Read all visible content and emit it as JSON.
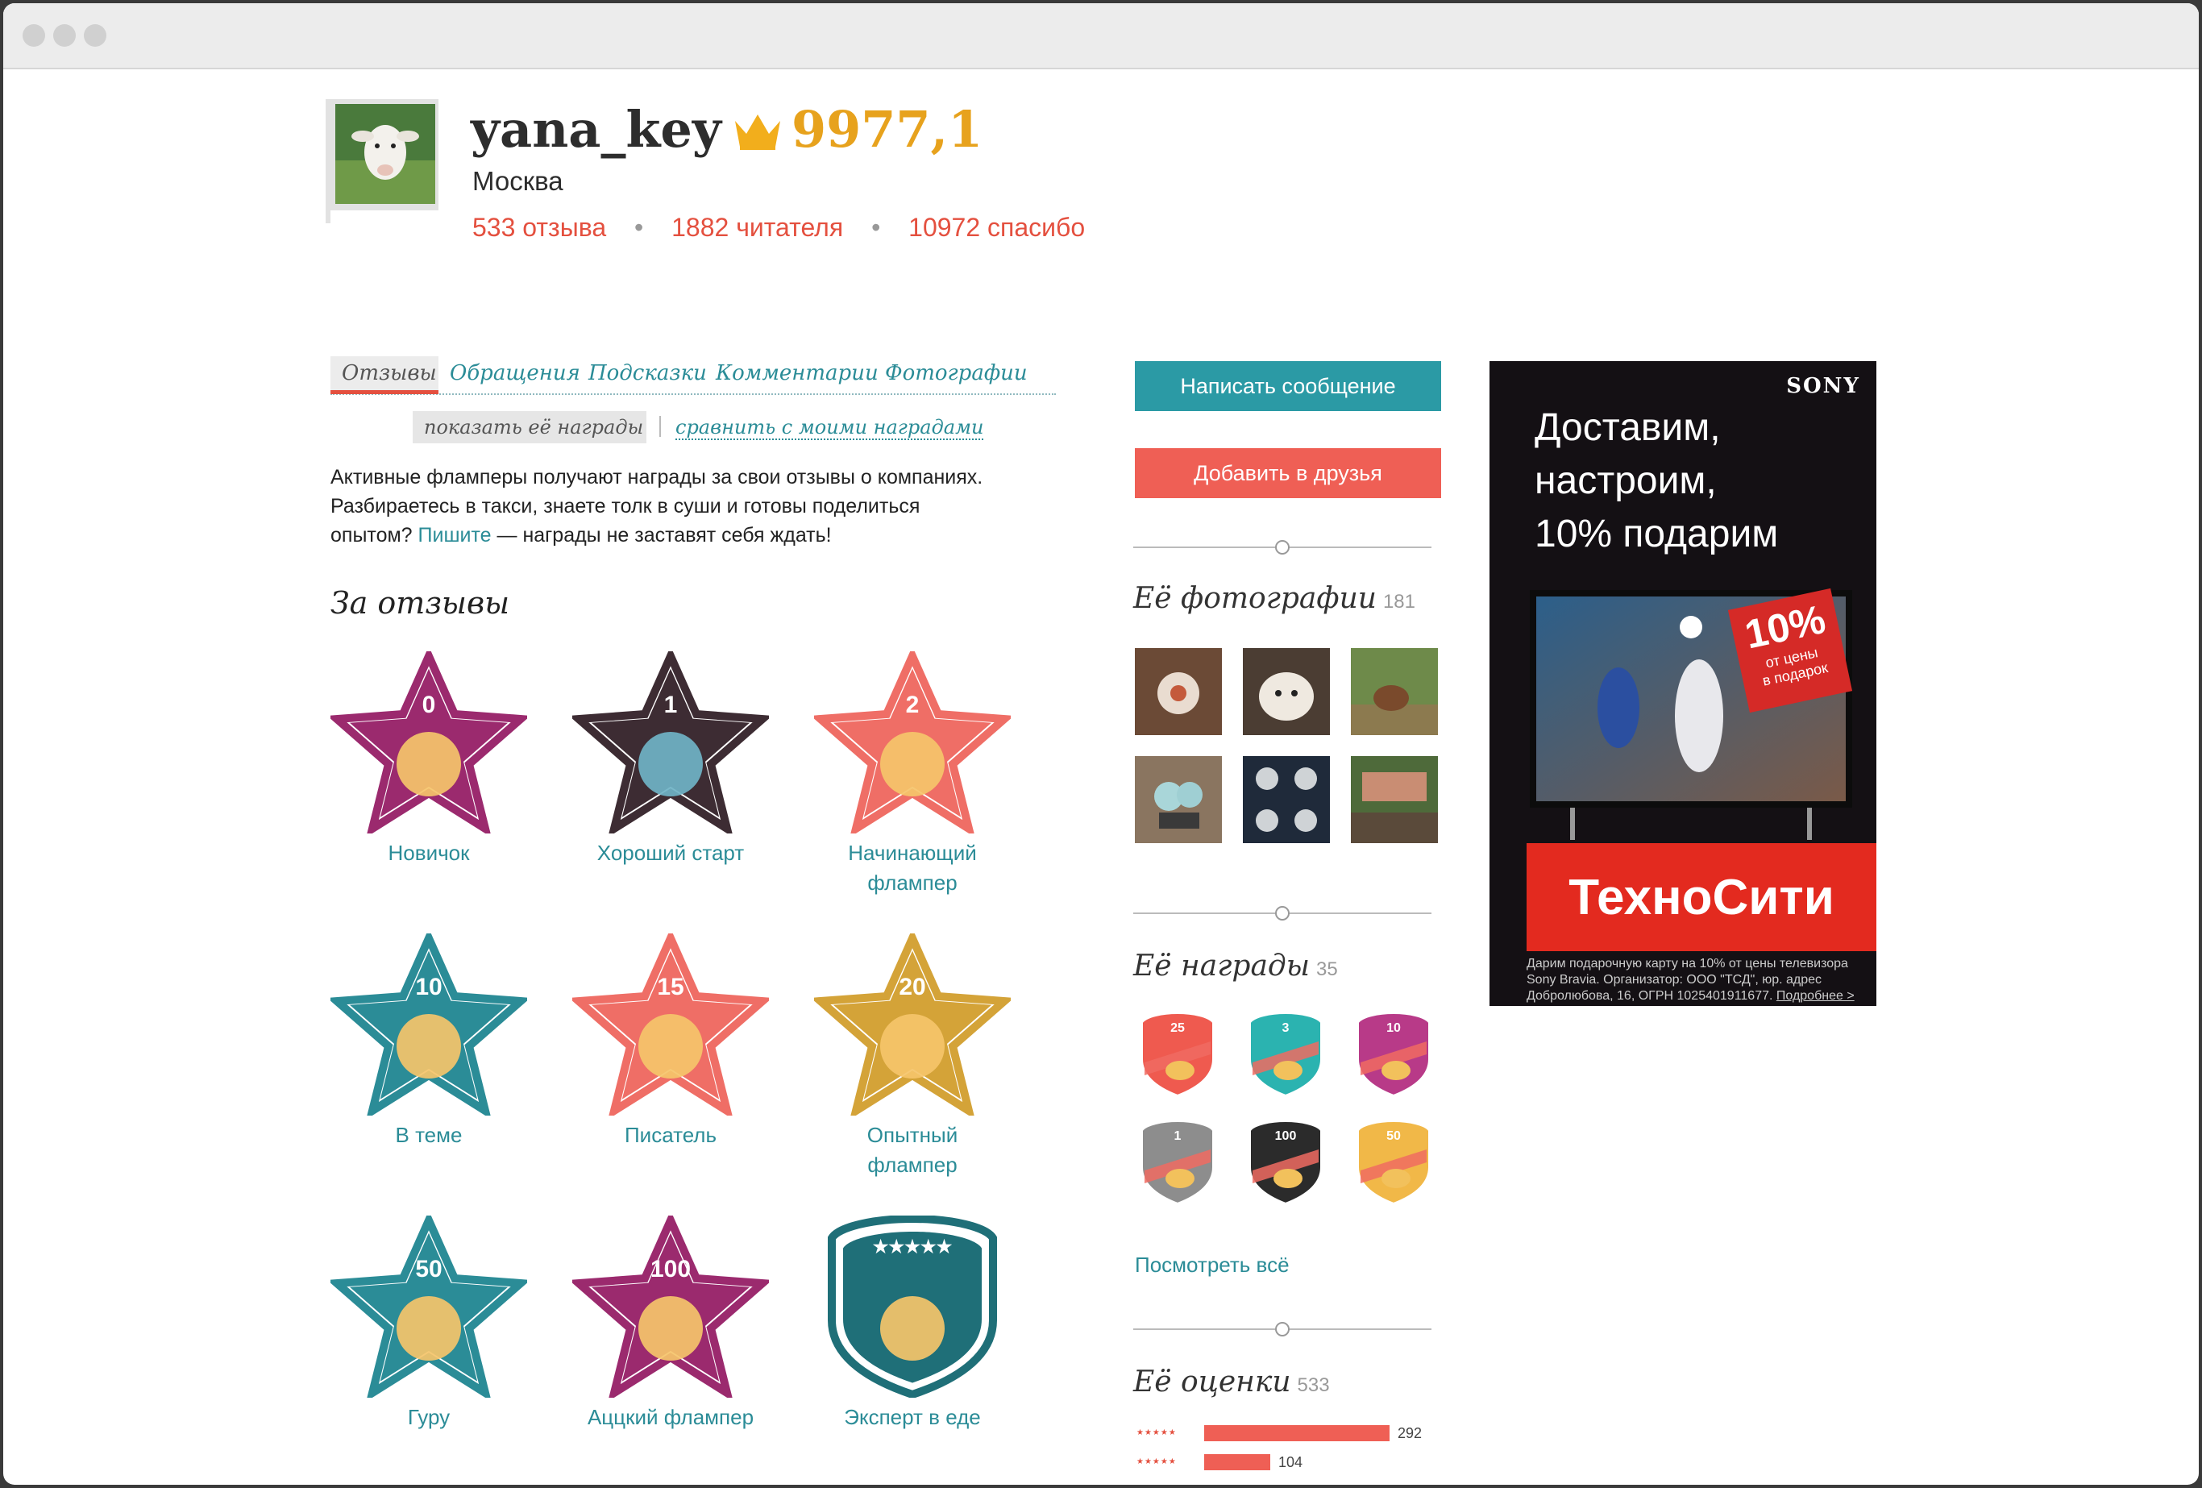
{
  "profile": {
    "username": "yana_key",
    "rating": "9977,1",
    "city": "Москва",
    "stats": {
      "reviews": "533 отзыва",
      "readers": "1882 читателя",
      "thanks": "10972 спасибо"
    },
    "separator": "•"
  },
  "tabs": [
    "Отзывы",
    "Обращения",
    "Подсказки",
    "Комментарии",
    "Фотографии"
  ],
  "subtabs": {
    "show": "показать её награды",
    "compare": "сравнить с моими наградами"
  },
  "intro": {
    "line1": "Активные фламперы получают награды за свои отзывы о компаниях.",
    "line2": "Разбираетесь в такси, знаете толк в суши и готовы поделиться",
    "line3a": "опытом?",
    "link": "Пишите",
    "line3b": "— награды не заставят себя ждать!"
  },
  "section_title": "За отзывы",
  "badges": [
    {
      "num": "0",
      "label1": "Новичок",
      "label2": "",
      "color": "#9b2a6e",
      "icon": "pacifier-icon"
    },
    {
      "num": "1",
      "label1": "Хороший старт",
      "label2": "",
      "color": "#3d2c33",
      "icon": "rocket-icon"
    },
    {
      "num": "2",
      "label1": "Начинающий",
      "label2": "флампер",
      "color": "#ef6e66",
      "icon": "megaphone-icon"
    },
    {
      "num": "10",
      "label1": "В теме",
      "label2": "",
      "color": "#2b8c97",
      "icon": "tablet-chat-icon"
    },
    {
      "num": "15",
      "label1": "Писатель",
      "label2": "",
      "color": "#ef6e66",
      "icon": "quill-icon"
    },
    {
      "num": "20",
      "label1": "Опытный",
      "label2": "флампер",
      "color": "#d4a338",
      "icon": "graduation-cap-icon"
    },
    {
      "num": "50",
      "label1": "Гуру",
      "label2": "",
      "color": "#2b8c97",
      "icon": "eye-icon"
    },
    {
      "num": "100",
      "label1": "Аццкий флампер",
      "label2": "",
      "color": "#9b2a6e",
      "icon": "fire-icon"
    },
    {
      "num": "★★★★★",
      "label1": "Эксперт в еде",
      "label2": "",
      "color": "#1f6f78",
      "icon": "chef-icon"
    }
  ],
  "buttons": {
    "message": "Написать сообщение",
    "friend": "Добавить в друзья"
  },
  "photos": {
    "title": "Её фотографии",
    "count": "181"
  },
  "awards": {
    "title": "Её награды",
    "count": "35",
    "items": [
      {
        "num": "25",
        "color": "#ef5a4f"
      },
      {
        "num": "3",
        "color": "#2bb3b0"
      },
      {
        "num": "10",
        "color": "#b83a88"
      },
      {
        "num": "1",
        "color": "#8d8d8d"
      },
      {
        "num": "100",
        "color": "#2b2b2b"
      },
      {
        "num": "50",
        "color": "#f1b848"
      }
    ],
    "view_all": "Посмотреть всё"
  },
  "ratings": {
    "title": "Её оценки",
    "count": "533",
    "rows": [
      {
        "stars": "★★★★★",
        "value": "292"
      },
      {
        "stars": "★★★★★",
        "value": "104"
      }
    ]
  },
  "ad": {
    "brand": "SONY",
    "line1": "Доставим,",
    "line2": "настроим,",
    "line3": "10% подарим",
    "promo_big": "10%",
    "promo_small1": "от цены",
    "promo_small2": "в подарок",
    "store": "ТехноСити",
    "fine1": "Дарим подарочную карту на 10% от цены телевизора",
    "fine2": "Sony Bravia. Организатор: ООО \"ТСД\", юр. адрес",
    "fine3": "Добролюбова, 16, ОГРН 1025401911677.",
    "more": "Подробнее >"
  },
  "colors": {
    "accent_red": "#e4503f",
    "accent_teal": "#2b8c97",
    "button_teal": "#2b9aa5",
    "button_red": "#ef5f55",
    "rating_gold": "#e7a21d"
  }
}
